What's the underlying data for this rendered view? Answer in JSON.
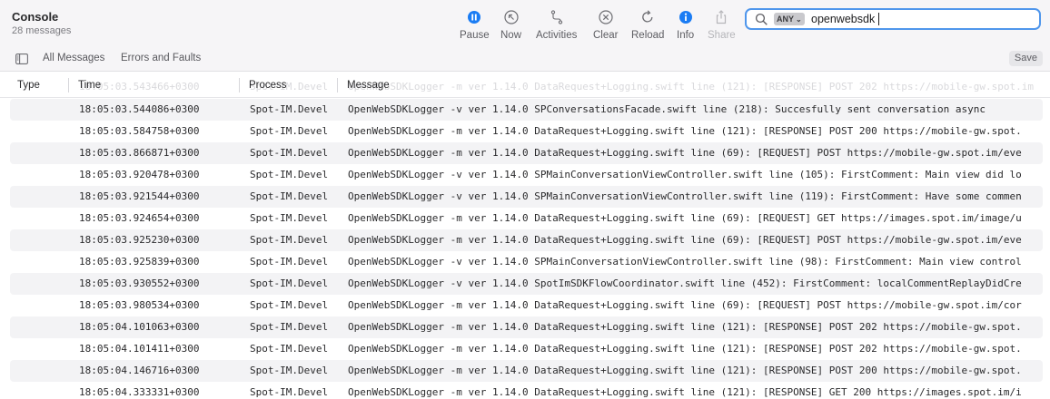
{
  "window": {
    "title": "Console",
    "subtitle": "28 messages"
  },
  "toolbar": {
    "pause": "Pause",
    "now": "Now",
    "activities": "Activities",
    "clear": "Clear",
    "reload": "Reload",
    "info": "Info",
    "share": "Share"
  },
  "search": {
    "scope": "ANY",
    "query": "openwebsdk"
  },
  "filters": {
    "all_messages": "All Messages",
    "errors_faults": "Errors and Faults",
    "save": "Save"
  },
  "columns": {
    "type": "Type",
    "time": "Time",
    "process": "Process",
    "message": "Message"
  },
  "ghost_row": {
    "time": "18:05:03.543466+0300",
    "process": "Spot-IM.Devel",
    "message": "OpenWebSDKLogger -m ver 1.14.0 DataRequest+Logging.swift line (121): [RESPONSE] POST 202 https://mobile-gw.spot.im"
  },
  "rows": [
    {
      "time": "18:05:03.544086+0300",
      "process": "Spot-IM.Devel",
      "message": "OpenWebSDKLogger -v ver 1.14.0 SPConversationsFacade.swift line (218): Succesfully sent conversation async"
    },
    {
      "time": "18:05:03.584758+0300",
      "process": "Spot-IM.Devel",
      "message": "OpenWebSDKLogger -m ver 1.14.0 DataRequest+Logging.swift line (121): [RESPONSE] POST 200 https://mobile-gw.spot."
    },
    {
      "time": "18:05:03.866871+0300",
      "process": "Spot-IM.Devel",
      "message": "OpenWebSDKLogger -m ver 1.14.0 DataRequest+Logging.swift line (69): [REQUEST] POST https://mobile-gw.spot.im/eve"
    },
    {
      "time": "18:05:03.920478+0300",
      "process": "Spot-IM.Devel",
      "message": "OpenWebSDKLogger -v ver 1.14.0 SPMainConversationViewController.swift line (105): FirstComment: Main view did lo"
    },
    {
      "time": "18:05:03.921544+0300",
      "process": "Spot-IM.Devel",
      "message": "OpenWebSDKLogger -v ver 1.14.0 SPMainConversationViewController.swift line (119): FirstComment: Have some commen"
    },
    {
      "time": "18:05:03.924654+0300",
      "process": "Spot-IM.Devel",
      "message": "OpenWebSDKLogger -m ver 1.14.0 DataRequest+Logging.swift line (69): [REQUEST] GET https://images.spot.im/image/u"
    },
    {
      "time": "18:05:03.925230+0300",
      "process": "Spot-IM.Devel",
      "message": "OpenWebSDKLogger -m ver 1.14.0 DataRequest+Logging.swift line (69): [REQUEST] POST https://mobile-gw.spot.im/eve"
    },
    {
      "time": "18:05:03.925839+0300",
      "process": "Spot-IM.Devel",
      "message": "OpenWebSDKLogger -v ver 1.14.0 SPMainConversationViewController.swift line (98): FirstComment: Main view control"
    },
    {
      "time": "18:05:03.930552+0300",
      "process": "Spot-IM.Devel",
      "message": "OpenWebSDKLogger -v ver 1.14.0 SpotImSDKFlowCoordinator.swift line (452): FirstComment: localCommentReplayDidCre"
    },
    {
      "time": "18:05:03.980534+0300",
      "process": "Spot-IM.Devel",
      "message": "OpenWebSDKLogger -m ver 1.14.0 DataRequest+Logging.swift line (69): [REQUEST] POST https://mobile-gw.spot.im/cor"
    },
    {
      "time": "18:05:04.101063+0300",
      "process": "Spot-IM.Devel",
      "message": "OpenWebSDKLogger -m ver 1.14.0 DataRequest+Logging.swift line (121): [RESPONSE] POST 202 https://mobile-gw.spot."
    },
    {
      "time": "18:05:04.101411+0300",
      "process": "Spot-IM.Devel",
      "message": "OpenWebSDKLogger -m ver 1.14.0 DataRequest+Logging.swift line (121): [RESPONSE] POST 202 https://mobile-gw.spot."
    },
    {
      "time": "18:05:04.146716+0300",
      "process": "Spot-IM.Devel",
      "message": "OpenWebSDKLogger -m ver 1.14.0 DataRequest+Logging.swift line (121): [RESPONSE] POST 200 https://mobile-gw.spot."
    },
    {
      "time": "18:05:04.333331+0300",
      "process": "Spot-IM.Devel",
      "message": "OpenWebSDKLogger -m ver 1.14.0 DataRequest+Logging.swift line (121): [RESPONSE] GET 200 https://images.spot.im/i"
    }
  ],
  "colors": {
    "accent": "#1a7cf4",
    "search_focus": "#4f96ec",
    "row_alt": "#f3f3f5"
  }
}
